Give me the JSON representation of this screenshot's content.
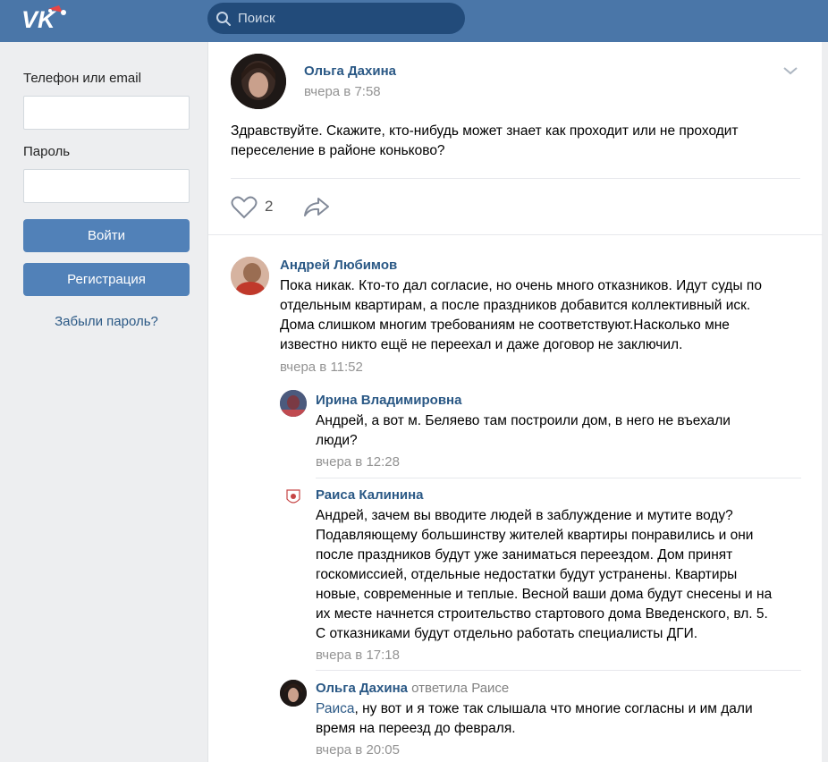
{
  "header": {
    "logo": "vk-logo",
    "search_placeholder": "Поиск"
  },
  "login": {
    "phone_label": "Телефон или email",
    "password_label": "Пароль",
    "login_button": "Войти",
    "register_button": "Регистрация",
    "forgot_link": "Забыли пароль?"
  },
  "post": {
    "author": "Ольга Дахина",
    "time": "вчера в 7:58",
    "text_line1": "Здравствуйте. Скажите, кто-нибудь может знает как проходит или не проходит",
    "text_line2": "переселение в районе коньково?",
    "likes": "2"
  },
  "comments": [
    {
      "author": "Андрей Любимов",
      "lines": [
        "Пока никак. Кто-то дал согласие, но очень много отказников. Идут суды по",
        "отдельным квартирам, а после праздников добавится коллективный иск.",
        "Дома слишком многим требованиям не соответствуют.Насколько мне",
        "известно никто ещё не переехал и даже договор не заключил."
      ],
      "time": "вчера в 11:52"
    },
    {
      "author": "Ирина Владимировна",
      "lines": [
        "Андрей, а вот м. Беляево там построили дом, в него не въехали",
        "люди?"
      ],
      "time": "вчера в 12:28"
    },
    {
      "author": "Раиса Калинина",
      "lines": [
        "Андрей, зачем вы вводите людей в заблуждение и мутите воду?",
        "Подавляющему большинству жителей квартиры понравились и они",
        "после праздников будут уже заниматься переездом. Дом принят",
        "госкомиссией, отдельные недостатки будут устранены. Квартиры",
        "новые, современные и теплые. Весной ваши дома будут снесены и на",
        "их месте начнется строительство стартового дома Введенского, вл. 5.",
        "С отказниками будут отдельно работать специалисты ДГИ."
      ],
      "time": "вчера в 17:18"
    },
    {
      "author": "Ольга Дахина",
      "replied_to": "ответила Раисе",
      "mention": "Раиса",
      "line1_rest": ", ну вот и я тоже так слышала что многие согласны и им дали",
      "line2": "время на переезд до февраля.",
      "time": "вчера в 20:05"
    }
  ]
}
